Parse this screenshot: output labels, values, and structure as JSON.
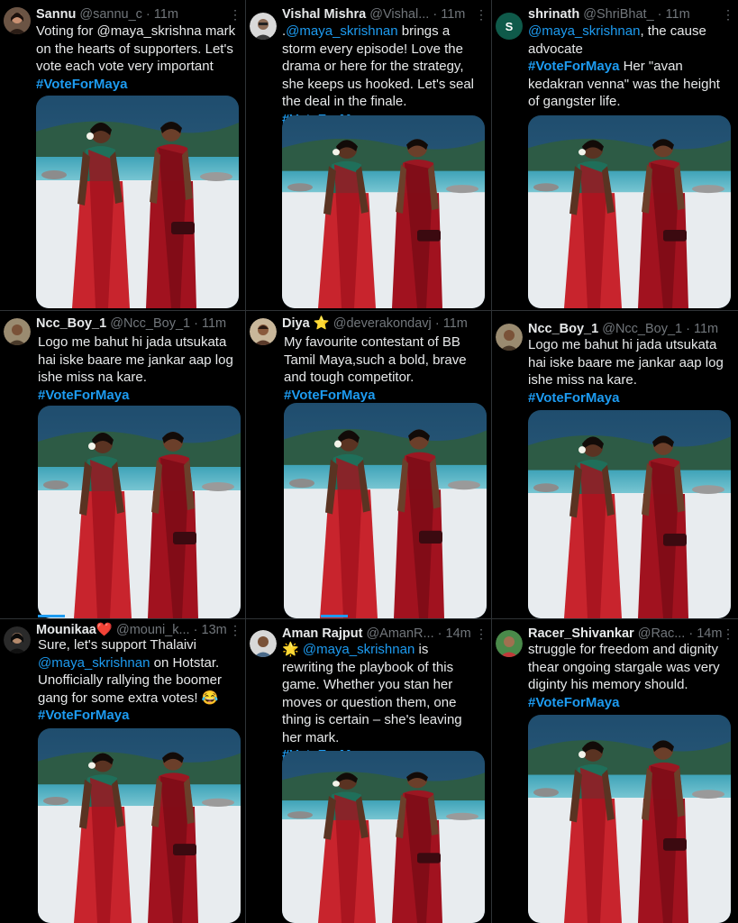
{
  "tweets": [
    {
      "name": "Sannu",
      "handle": "@sannu_c",
      "time": "11m",
      "text_a": "Voting for @maya_skrishna  mark on the hearts of supporters. Let's vote each vote very important",
      "hashtag": "#VoteForMaya",
      "avatar_icon": "woman-portrait-avatar"
    },
    {
      "name": "Vishal Mishra",
      "handle": "@Vishal...",
      "time": "11m",
      "text_pre": ".",
      "mention": "@maya_skrishnan",
      "text_a": " brings a storm every episode! Love the drama or here for the strategy, she keeps us hooked. Let's seal the deal in the finale. ",
      "hashtag": "#VoteForMaya",
      "avatar_icon": "man-portrait-avatar"
    },
    {
      "name": "shrinath",
      "handle": "@ShriBhat_",
      "time": "11m",
      "avatar_letter": "S",
      "mention": "@maya_skrishnan",
      "text_a": ", the cause advocate",
      "hashtag": "#VoteForMaya",
      "text_b": " Her \"avan kedakran venna\" was the height of gangster life."
    },
    {
      "name": "Ncc_Boy_1",
      "handle": "@Ncc_Boy_1",
      "time": "11m",
      "text_a": "Logo me bahut hi jada utsukata hai iske baare me jankar aap log ishe miss na kare.",
      "hashtag": "#VoteForMaya",
      "avatar_icon": "man-portrait-avatar"
    },
    {
      "name": "Diya ⭐",
      "handle": "@deverakondavj",
      "time": "11m",
      "text_a": "My favourite contestant of BB Tamil Maya,such a bold, brave and tough competitor.",
      "hashtag": "#VoteForMaya",
      "avatar_icon": "man-portrait-avatar"
    },
    {
      "name": "Ncc_Boy_1",
      "handle": "@Ncc_Boy_1",
      "time": "11m",
      "text_a": "Logo me bahut hi jada utsukata hai iske baare me jankar aap log ishe miss na kare.",
      "hashtag": "#VoteForMaya",
      "avatar_icon": "man-portrait-avatar"
    },
    {
      "name": "Mounikaa❤️",
      "handle": "@mouni_k...",
      "time": "13m",
      "text_a": "Sure, let's support Thalaivi ",
      "mention": "@maya_skrishnan",
      "text_b": " on Hotstar. Unofficially rallying the boomer gang for some extra votes! 😂",
      "hashtag": "#VoteForMaya",
      "avatar_icon": "woman-portrait-avatar"
    },
    {
      "name": "Aman Rajput",
      "handle": "@AmanR...",
      "time": "14m",
      "text_pre": "🌟 ",
      "mention": "@maya_skrishnan",
      "text_a": " is rewriting the playbook of this game. Whether you stan her moves or question them, one thing is certain – she's leaving her mark.",
      "hashtag": "#VoteForMaya",
      "avatar_icon": "man-portrait-avatar"
    },
    {
      "name": "Racer_Shivankar",
      "handle": "@Rac...",
      "time": "14m",
      "text_a": "struggle for freedom and dignity thear ongoing stargale was very diginty his memory should.",
      "hashtag": "#VoteForMaya",
      "avatar_icon": "man-portrait-avatar"
    }
  ],
  "more_glyph": "⋮",
  "dot_glyph": "·",
  "colors": {
    "accent": "#1d9bf0",
    "background": "#000000",
    "muted": "#71767b"
  },
  "photo_icon": "two-women-in-sarees-photo"
}
